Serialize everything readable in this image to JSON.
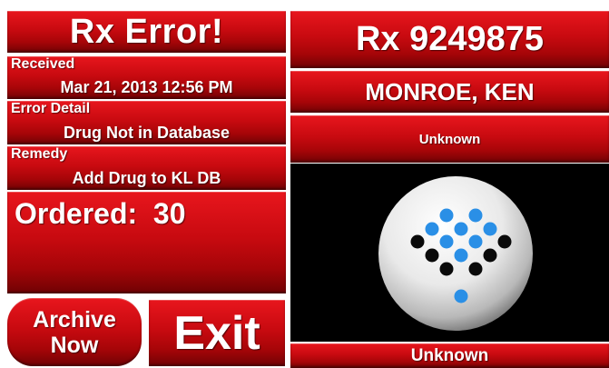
{
  "left": {
    "title": "Rx Error!",
    "received_label": "Received",
    "received_value": "Mar 21, 2013 12:56 PM",
    "error_label": "Error Detail",
    "error_value": "Drug Not in Database",
    "remedy_label": "Remedy",
    "remedy_value": "Add Drug to KL DB",
    "ordered": "Ordered:  30"
  },
  "buttons": {
    "archive_line1": "Archive",
    "archive_line2": "Now",
    "exit": "Exit"
  },
  "right": {
    "rx_number": "Rx 9249875",
    "patient_name": "MONROE, KEN",
    "top_status": "Unknown",
    "bottom_status": "Unknown",
    "pill_colors": {
      "blue": "#2a8fe6",
      "black": "#0a0a0a"
    }
  },
  "colors": {
    "panel_red": "#c80a10",
    "display_bg": "#000000",
    "text": "#ffffff"
  }
}
